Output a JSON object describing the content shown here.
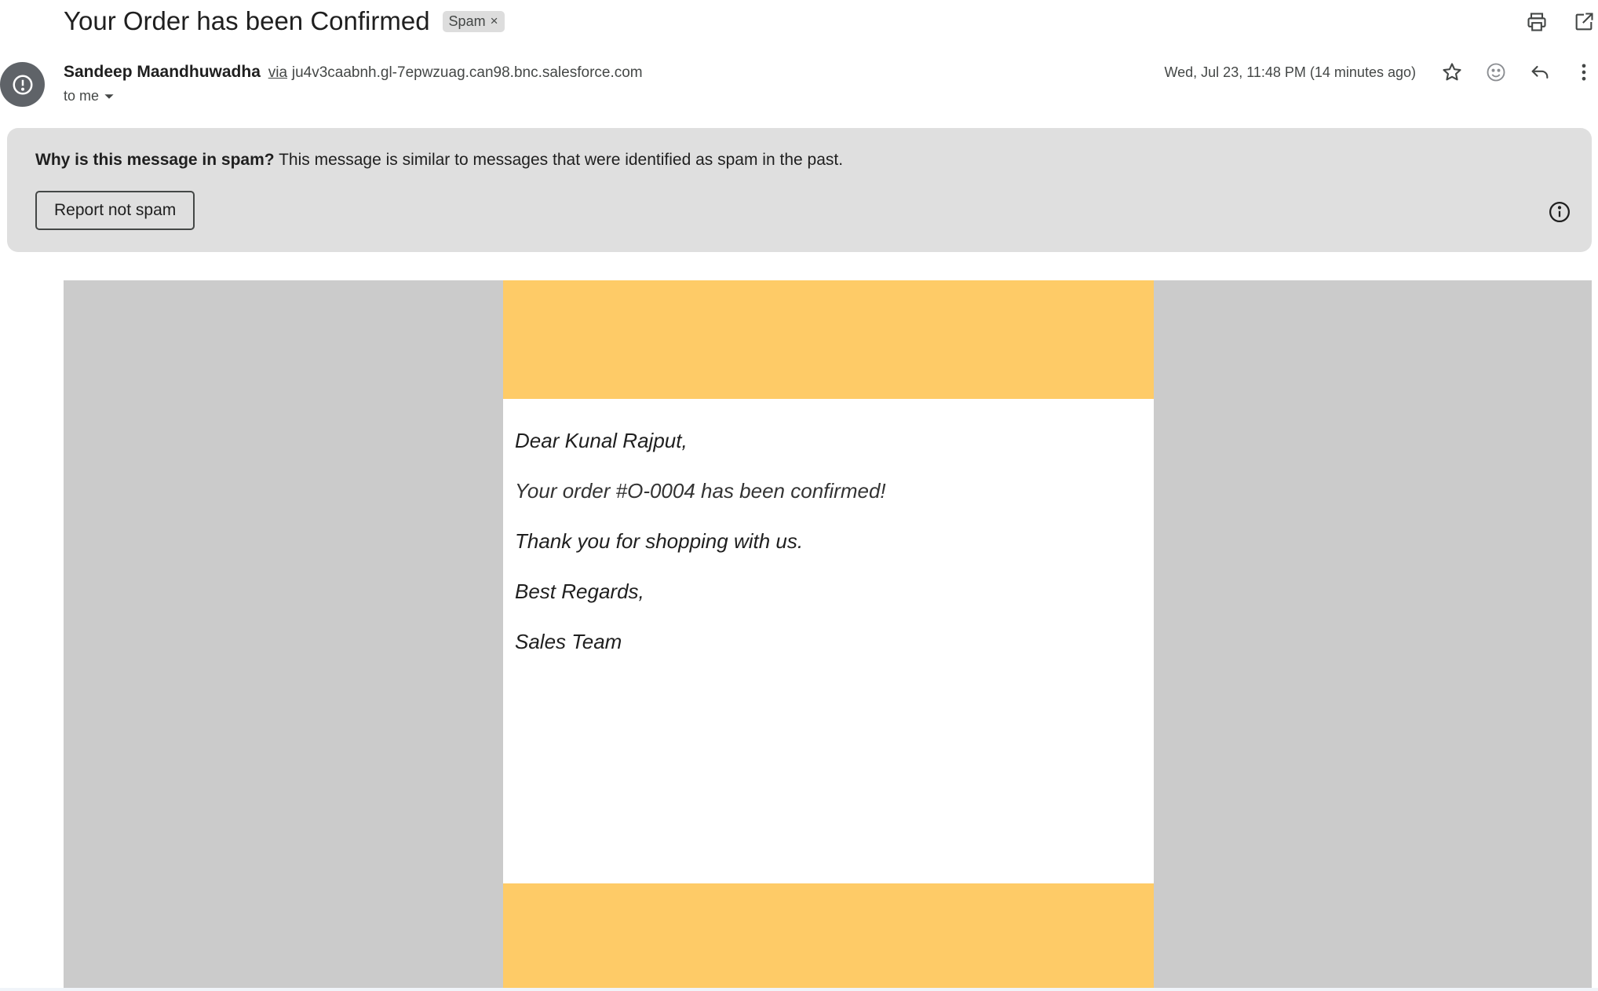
{
  "email": {
    "subject": "Your Order has been Confirmed",
    "label": "Spam",
    "label_remove": "×",
    "sender_name": "Sandeep Maandhuwadha",
    "via": "via",
    "sender_domain": "ju4v3caabnh.gl-7epwzuag.can98.bnc.salesforce.com",
    "recipient": "to me",
    "timestamp": "Wed, Jul 23, 11:48 PM (14 minutes ago)"
  },
  "spam_banner": {
    "question": "Why is this message in spam?",
    "explanation": "This message is similar to messages that were identified as spam in the past.",
    "report_button": "Report not spam"
  },
  "body": {
    "greeting": "Dear Kunal Rajput,",
    "order_line": "Your order #O-0004 has been confirmed!",
    "thanks": "Thank you for shopping with us.",
    "regards": "Best Regards,",
    "signature": "Sales Team"
  },
  "icons": {
    "print": "print-icon",
    "open_new_window": "open-in-new-window-icon",
    "star": "star-icon",
    "emoji": "emoji-reaction-icon",
    "reply": "reply-icon",
    "more": "more-vert-icon",
    "avatar": "spam-alert-icon",
    "info": "info-icon",
    "dropdown": "caret-down-icon"
  },
  "colors": {
    "banner_bg": "#dfdfdf",
    "email_outer_bg": "#cbcbcb",
    "email_band": "#fecb67",
    "avatar_bg": "#5f6368"
  }
}
